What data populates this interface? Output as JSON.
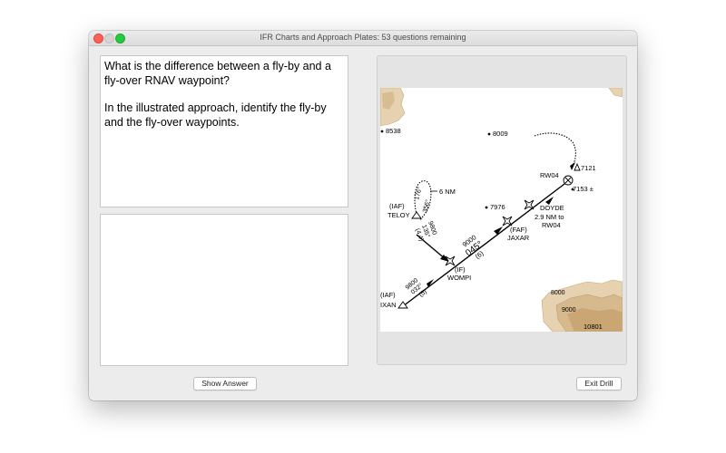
{
  "window": {
    "title": "IFR Charts and Approach Plates:  53 questions remaining"
  },
  "question": {
    "line1": "What is the difference between a fly-by and a fly-over RNAV waypoint?",
    "line2": "In the illustrated approach, identify the fly-by and the fly-over waypoints."
  },
  "answer": {
    "text": ""
  },
  "buttons": {
    "show_answer": "Show Answer",
    "exit_drill": "Exit Drill"
  },
  "chart": {
    "elev_8538": "8538",
    "elev_8009": "8009",
    "elev_7121": "7121",
    "elev_7153": "7153 ±",
    "elev_7976": "7976",
    "elev_8000": "8000",
    "elev_9000": "9000",
    "elev_10801": "10801",
    "wp_rw04": "RW04",
    "wp_doyde": "DOYDE",
    "doyde_dist": "2.9 NM to",
    "doyde_rw": "RW04",
    "faf_label": "(FAF)",
    "faf_name": "JAXAR",
    "if_label": "(IF)",
    "if_name": "WOMPI",
    "iaf_label_top": "(IAF)",
    "iaf_name_top": "TELOY",
    "iaf_label_bottom": "(IAF)",
    "iaf_name_bottom": "IXAN",
    "hold_nm": "6 NM",
    "hold_in": "176°",
    "hold_out": "356°",
    "seg_alt_main": "9000",
    "seg_crs_main": "045°",
    "seg_dist_main": "(6)",
    "seg_alt_teloy": "9800",
    "seg_crs_teloy": "135°",
    "seg_dist_teloy": "(4.4)",
    "seg_alt_ixan": "9800",
    "seg_crs_ixan": "032°",
    "seg_dist_ixan": "(5)"
  }
}
